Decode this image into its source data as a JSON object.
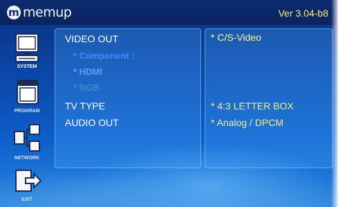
{
  "header": {
    "logo_mark": "m",
    "logo_text": "memup",
    "version": "Ver 3.04-b8"
  },
  "sidebar": {
    "items": [
      {
        "label": "SYSTEM",
        "icon": "monitor-icon",
        "active": true
      },
      {
        "label": "PROGRAM",
        "icon": "window-icon",
        "active": false
      },
      {
        "label": "NETWORK",
        "icon": "network-icon",
        "active": false
      },
      {
        "label": "EXIT",
        "icon": "exit-icon",
        "active": false
      }
    ]
  },
  "menu": {
    "video_out": {
      "label": "VIDEO OUT",
      "options": [
        {
          "label": "* Component :",
          "color": "#3d8dff"
        },
        {
          "label": "* HDMI",
          "color": "#5aa2f0"
        },
        {
          "label": "* RGB",
          "color": "#4f8fd6"
        }
      ],
      "value": "* C/S-Video"
    },
    "tv_type": {
      "label": "TV TYPE",
      "value": "* 4:3 LETTER BOX"
    },
    "audio_out": {
      "label": "AUDIO OUT",
      "value": "* Analog / DPCM"
    }
  },
  "colors": {
    "value_text": "#f4f07a",
    "version_text": "#f4f07a",
    "menu_text": "#ffffff"
  }
}
